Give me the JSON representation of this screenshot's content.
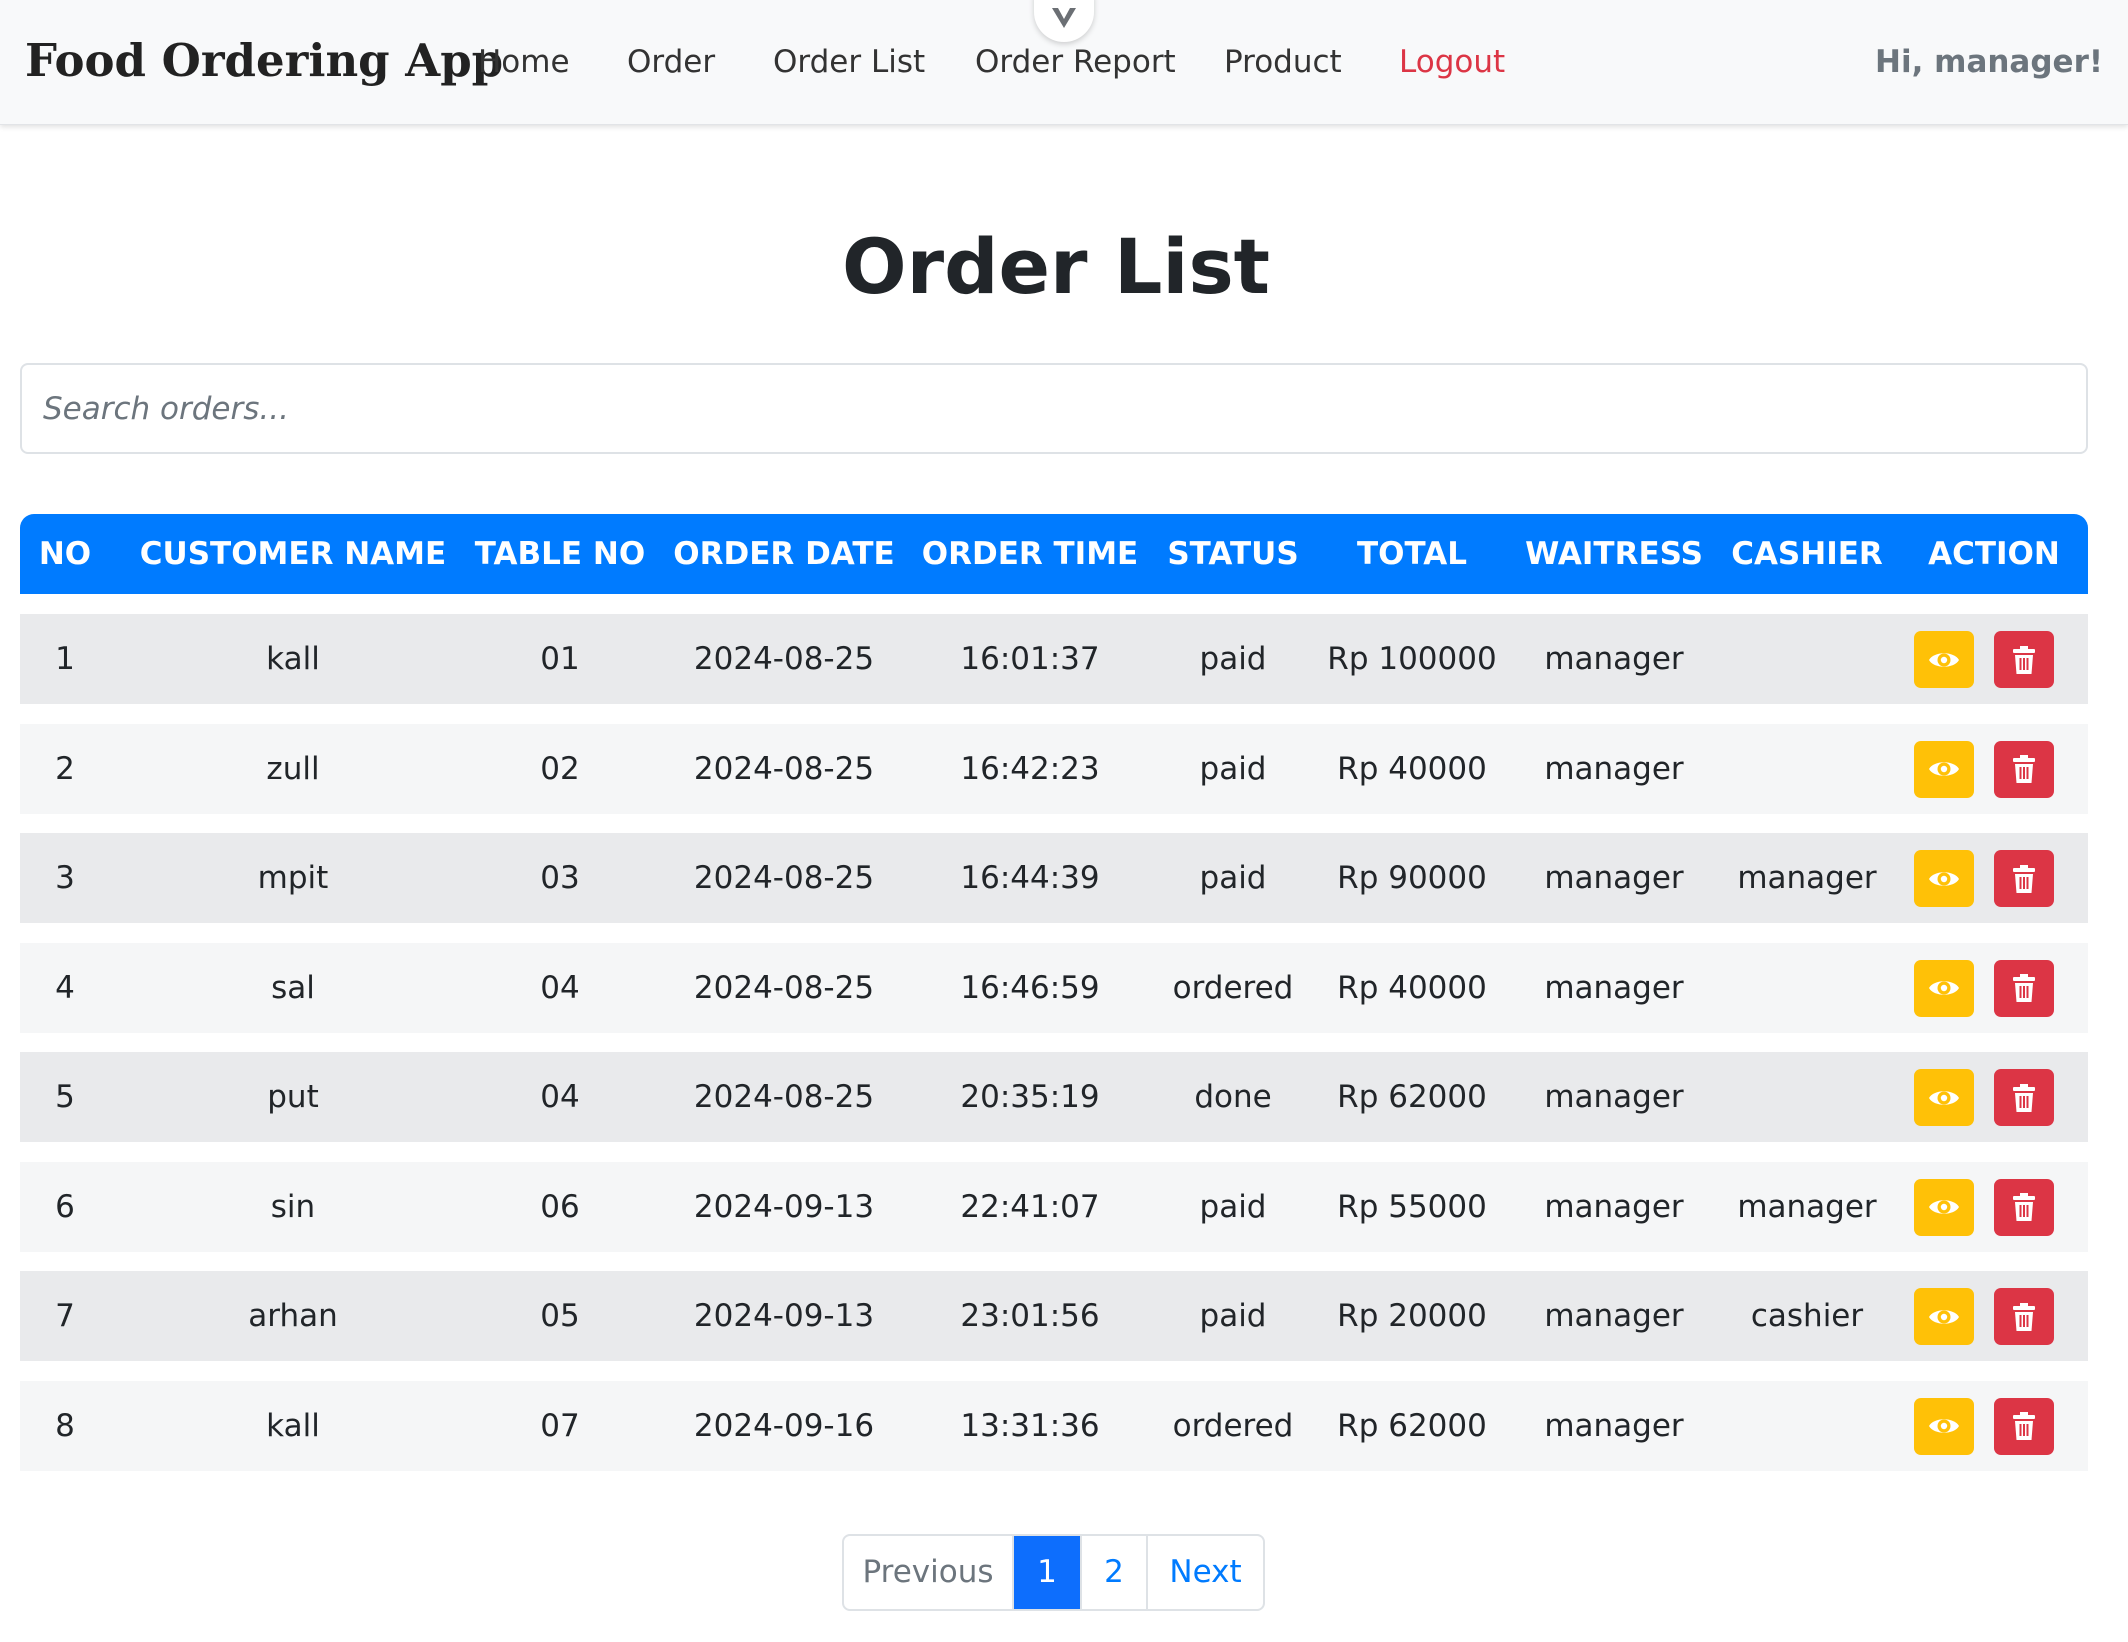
{
  "navbar": {
    "brand": "Food Ordering App",
    "links": [
      "Home",
      "Order",
      "Order List",
      "Order Report",
      "Product"
    ],
    "logout": "Logout",
    "greeting": "Hi, manager!"
  },
  "page": {
    "title": "Order List"
  },
  "search": {
    "placeholder": "Search orders..."
  },
  "table": {
    "headers": [
      "NO",
      "CUSTOMER NAME",
      "TABLE NO",
      "ORDER DATE",
      "ORDER TIME",
      "STATUS",
      "TOTAL",
      "WAITRESS",
      "CASHIER",
      "ACTION"
    ],
    "rows": [
      [
        "1",
        "kall",
        "01",
        "2024-08-25",
        "16:01:37",
        "paid",
        "Rp 100000",
        "manager",
        ""
      ],
      [
        "2",
        "zull",
        "02",
        "2024-08-25",
        "16:42:23",
        "paid",
        "Rp 40000",
        "manager",
        ""
      ],
      [
        "3",
        "mpit",
        "03",
        "2024-08-25",
        "16:44:39",
        "paid",
        "Rp 90000",
        "manager",
        "manager"
      ],
      [
        "4",
        "sal",
        "04",
        "2024-08-25",
        "16:46:59",
        "ordered",
        "Rp 40000",
        "manager",
        ""
      ],
      [
        "5",
        "put",
        "04",
        "2024-08-25",
        "20:35:19",
        "done",
        "Rp 62000",
        "manager",
        ""
      ],
      [
        "6",
        "sin",
        "06",
        "2024-09-13",
        "22:41:07",
        "paid",
        "Rp 55000",
        "manager",
        "manager"
      ],
      [
        "7",
        "arhan",
        "05",
        "2024-09-13",
        "23:01:56",
        "paid",
        "Rp 20000",
        "manager",
        "cashier"
      ],
      [
        "8",
        "kall",
        "07",
        "2024-09-16",
        "13:31:36",
        "ordered",
        "Rp 62000",
        "manager",
        ""
      ]
    ],
    "row_actions": {
      "view_icon": "eye-icon",
      "delete_icon": "trash-icon"
    }
  },
  "pagination": {
    "previous": "Previous",
    "pages": [
      "1",
      "2"
    ],
    "active_page": "1",
    "next": "Next"
  },
  "colors": {
    "primary": "#007bff",
    "danger": "#dc3545",
    "warning": "#ffc107",
    "navbar_bg": "#f8f9fa",
    "row_odd": "#e9eaec",
    "row_even": "#f5f6f7"
  }
}
